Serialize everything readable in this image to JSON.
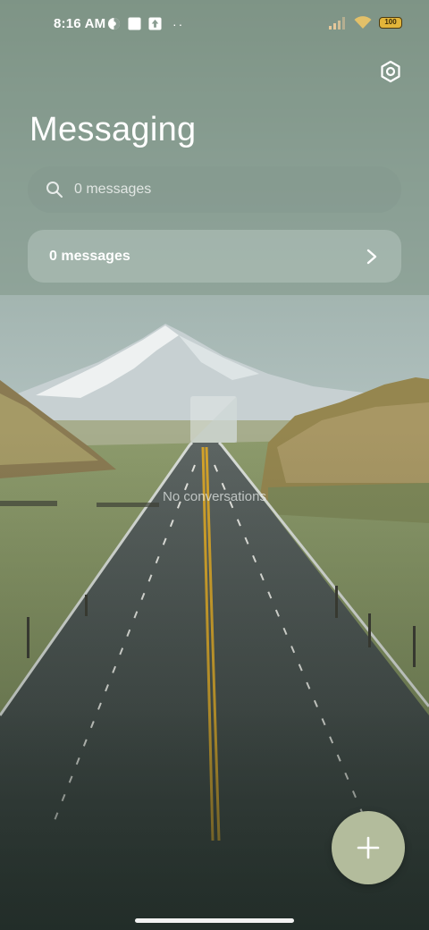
{
  "status_bar": {
    "time": "8:16 AM",
    "battery": "100",
    "left_icons": [
      "vpn-key-icon",
      "square-notification-icon",
      "upload-notification-icon"
    ],
    "overflow": "··"
  },
  "header": {
    "title": "Messaging",
    "settings_icon": "gear-hexagon-icon"
  },
  "search": {
    "placeholder": "0 messages",
    "value": ""
  },
  "messages_row": {
    "label": "0 messages"
  },
  "empty_state": {
    "text": "No conversations"
  },
  "fab": {
    "icon": "plus-icon"
  },
  "colors": {
    "accent_fab": "#b3bc9c",
    "text": "#ffffff"
  }
}
